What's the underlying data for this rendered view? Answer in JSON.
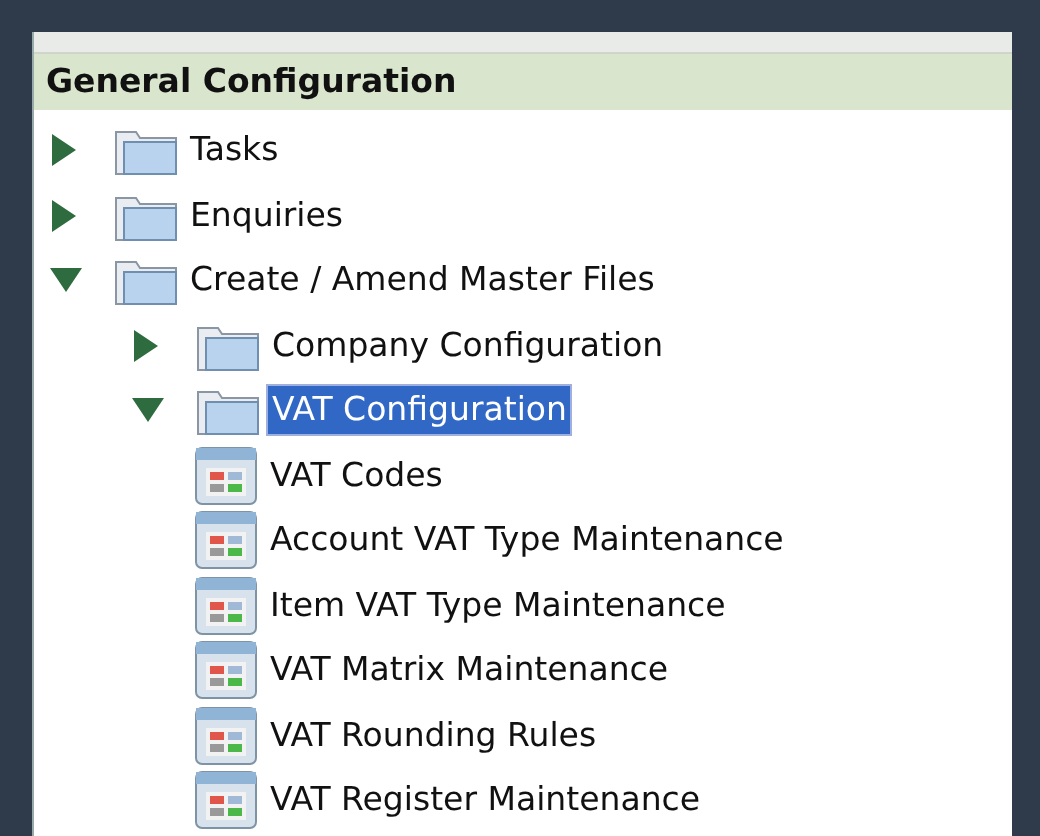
{
  "panel": {
    "title": "General Configuration"
  },
  "tree": [
    {
      "label": "Tasks",
      "kind": "folder",
      "expanded": false,
      "selected": false
    },
    {
      "label": "Enquiries",
      "kind": "folder",
      "expanded": false,
      "selected": false
    },
    {
      "label": "Create / Amend Master Files",
      "kind": "folder",
      "expanded": true,
      "selected": false,
      "children": [
        {
          "label": "Company Configuration",
          "kind": "folder",
          "expanded": false,
          "selected": false
        },
        {
          "label": "VAT Configuration",
          "kind": "folder",
          "expanded": true,
          "selected": true,
          "children": [
            {
              "label": "VAT Codes",
              "kind": "form",
              "selected": false
            },
            {
              "label": "Account VAT Type Maintenance",
              "kind": "form",
              "selected": false
            },
            {
              "label": "Item VAT Type Maintenance",
              "kind": "form",
              "selected": false
            },
            {
              "label": "VAT Matrix Maintenance",
              "kind": "form",
              "selected": false
            },
            {
              "label": "VAT Rounding Rules",
              "kind": "form",
              "selected": false
            },
            {
              "label": "VAT Register Maintenance",
              "kind": "form",
              "selected": false
            }
          ]
        }
      ]
    }
  ]
}
